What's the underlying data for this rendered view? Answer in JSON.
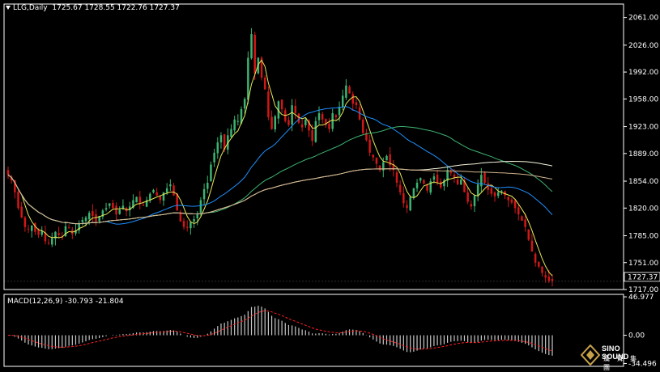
{
  "main_header": {
    "symbol": "LLG,Daily",
    "ohlc": "1725.67 1728.55 1722.76 1727.37"
  },
  "macd_header": {
    "label": "MACD(12,26,9)",
    "values": "-30.793 -21.804"
  },
  "watermark": {
    "brand": "SINO SOUND",
    "sub": "漢 聲 集 團"
  },
  "chart_data": [
    {
      "type": "candlestick",
      "title": "LLG,Daily",
      "ylim": [
        1717.0,
        2078.0
      ],
      "y_ticks": [
        "2061.00",
        "2026.00",
        "1992.00",
        "1958.00",
        "1923.00",
        "1889.00",
        "1854.00",
        "1820.00",
        "1785.00",
        "1751.00",
        "1717.00"
      ],
      "last_price": "1727.37",
      "colors": {
        "up": "#3cb371",
        "down": "#d01818",
        "background": "#000000"
      },
      "candles_close": [
        1862,
        1855,
        1840,
        1820,
        1808,
        1796,
        1793,
        1798,
        1790,
        1786,
        1791,
        1778,
        1776,
        1782,
        1790,
        1786,
        1783,
        1797,
        1795,
        1787,
        1792,
        1800,
        1805,
        1808,
        1814,
        1810,
        1803,
        1810,
        1817,
        1820,
        1826,
        1820,
        1812,
        1818,
        1823,
        1816,
        1822,
        1830,
        1834,
        1826,
        1823,
        1830,
        1838,
        1843,
        1836,
        1830,
        1840,
        1845,
        1850,
        1836,
        1817,
        1803,
        1796,
        1795,
        1802,
        1806,
        1812,
        1830,
        1844,
        1852,
        1875,
        1890,
        1903,
        1912,
        1894,
        1912,
        1920,
        1932,
        1930,
        1945,
        1958,
        2010,
        2040,
        1990,
        2010,
        1985,
        1970,
        1935,
        1920,
        1936,
        1955,
        1945,
        1930,
        1925,
        1950,
        1940,
        1928,
        1922,
        1932,
        1918,
        1905,
        1930,
        1940,
        1932,
        1925,
        1920,
        1940,
        1935,
        1948,
        1962,
        1975,
        1965,
        1952,
        1950,
        1932,
        1915,
        1906,
        1890,
        1884,
        1876,
        1868,
        1878,
        1886,
        1874,
        1868,
        1852,
        1840,
        1826,
        1820,
        1834,
        1845,
        1852,
        1858,
        1851,
        1842,
        1854,
        1860,
        1852,
        1846,
        1855,
        1868,
        1864,
        1858,
        1850,
        1856,
        1840,
        1828,
        1822,
        1836,
        1850,
        1862,
        1852,
        1843,
        1838,
        1835,
        1840,
        1842,
        1836,
        1830,
        1827,
        1820,
        1812,
        1804,
        1796,
        1780,
        1765,
        1751,
        1746,
        1738,
        1732,
        1728,
        1727.37
      ],
      "moving_averages": [
        {
          "color": "#e8e85a"
        },
        {
          "color": "#1e90ff"
        },
        {
          "color": "#3cb371"
        },
        {
          "color": "#f5f5dc"
        },
        {
          "color": "#d2b48c"
        }
      ]
    },
    {
      "type": "bar",
      "title": "MACD(12,26,9)",
      "ylim": [
        -38.0,
        50.0
      ],
      "y_ticks": [
        "46.977",
        "0.00",
        "-34.496"
      ],
      "colors": {
        "histogram": "#c8c8c8",
        "signal": "#ff2020"
      }
    }
  ]
}
